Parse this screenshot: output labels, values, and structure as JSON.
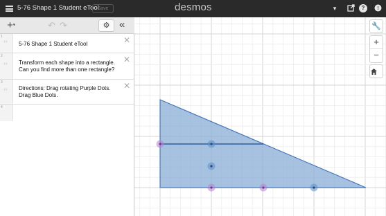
{
  "topbar": {
    "title": "5-76 Shape 1 Student eTool",
    "save_label": "Save",
    "brand": "desmos"
  },
  "panel": {
    "add_label": "+",
    "expressions": [
      {
        "index": "1",
        "lines": [
          "5-76 Shape 1 Student eTool"
        ]
      },
      {
        "index": "2",
        "lines": [
          "Transform each shape into a rectangle.",
          "Can you find more than one rectangle?"
        ]
      },
      {
        "index": "3",
        "lines": [
          "Directions: Drag rotating Purple Dots.",
          "Drag Blue Dots."
        ]
      },
      {
        "index": "4",
        "lines": []
      }
    ]
  },
  "graph": {
    "colors": {
      "fill": "#8aaed6",
      "edge": "#4a78b8",
      "purple_point": "#b47fd0",
      "blue_point": "#5f8fc6",
      "grid_minor": "#ececec",
      "grid_major": "#d4d4d4"
    },
    "points": [
      {
        "color": "purple"
      },
      {
        "color": "blue"
      },
      {
        "color": "blue"
      },
      {
        "color": "purple"
      },
      {
        "color": "purple"
      },
      {
        "color": "blue"
      }
    ]
  },
  "icons": {
    "menu": "hamburger-icon",
    "dropdown": "caret-down-icon",
    "share": "share-icon",
    "help": "help-icon",
    "signin": "signin-icon",
    "settings": "gear-icon",
    "collapse": "double-chevron-left-icon",
    "wrench": "wrench-icon",
    "zoom_in": "plus-icon",
    "zoom_out": "minus-icon",
    "home": "home-icon"
  }
}
